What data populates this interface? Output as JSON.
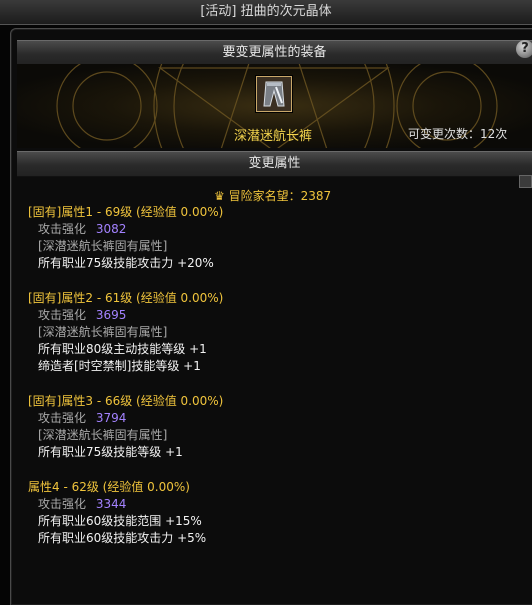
{
  "window": {
    "title": "[活动] 扭曲的次元晶体"
  },
  "equip_section": {
    "header": "要变更属性的装备",
    "item_name": "深潜迷航长裤",
    "change_count": "可变更次数：12次"
  },
  "change_section": {
    "header": "变更属性",
    "fame_label": "冒险家名望：2387"
  },
  "attributes": [
    {
      "title": "[固有]属性1 - 69级 (经验值 0.00%)",
      "stat_label": "攻击强化",
      "stat_value": "3082",
      "set_note": "[深潜迷航长裤固有属性]",
      "effects": [
        "所有职业75级技能攻击力 +20%"
      ]
    },
    {
      "title": "[固有]属性2 - 61级 (经验值 0.00%)",
      "stat_label": "攻击强化",
      "stat_value": "3695",
      "set_note": "[深潜迷航长裤固有属性]",
      "effects": [
        "所有职业80级主动技能等级 +1",
        "缔造者[时空禁制]技能等级 +1"
      ]
    },
    {
      "title": "[固有]属性3 - 66级 (经验值 0.00%)",
      "stat_label": "攻击强化",
      "stat_value": "3794",
      "set_note": "[深潜迷航长裤固有属性]",
      "effects": [
        "所有职业75级技能等级 +1"
      ]
    },
    {
      "title": "属性4 - 62级 (经验值 0.00%)",
      "stat_label": "攻击强化",
      "stat_value": "3344",
      "effects": [
        "所有职业60级技能范围 +15%",
        "所有职业60级技能攻击力 +5%"
      ]
    }
  ],
  "icons": {
    "help": "help-icon",
    "item": "pants-item-icon",
    "fame": "fame-crown-icon"
  },
  "colors": {
    "gold": "#f0c43c",
    "item_name": "#f2d34d",
    "purple_value": "#a382ff",
    "note_gray": "#a9a9a9"
  }
}
